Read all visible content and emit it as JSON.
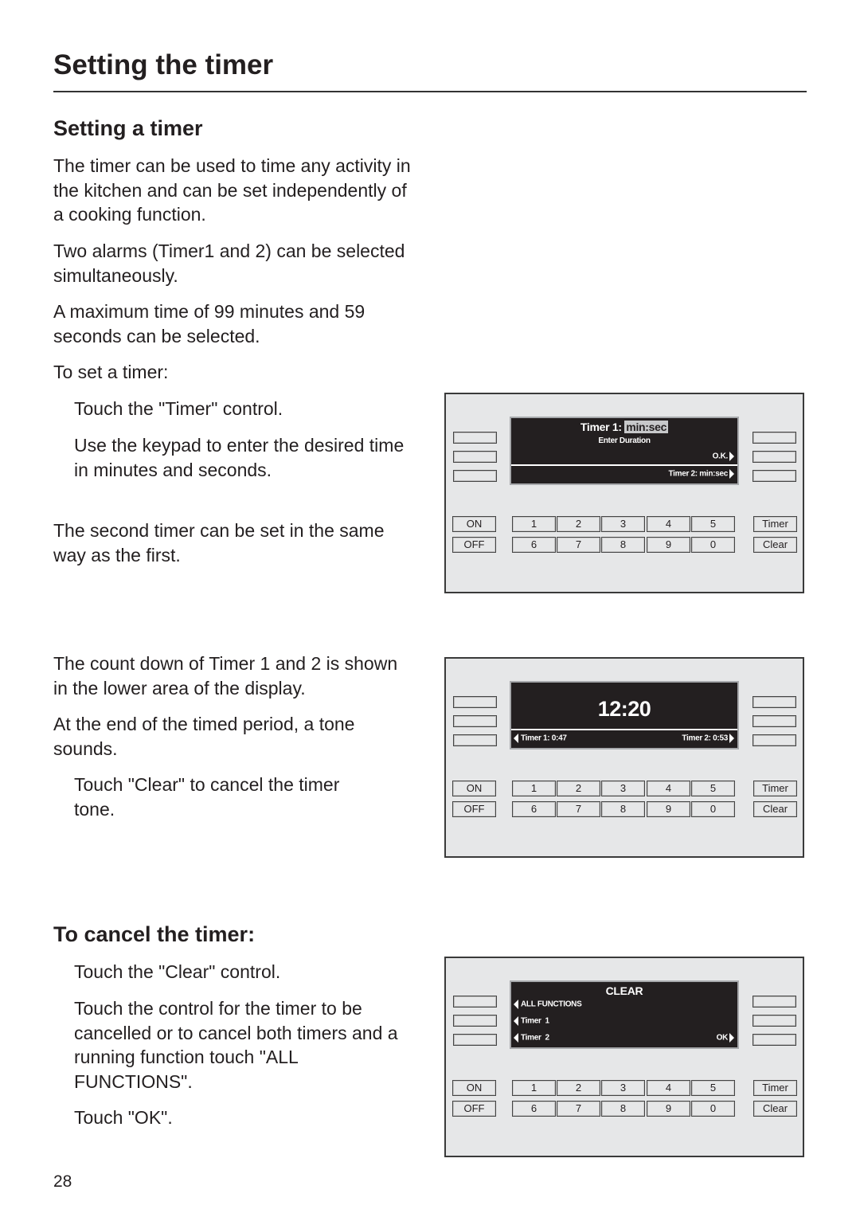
{
  "page": {
    "title": "Setting the timer",
    "page_number": "28"
  },
  "section_setting": {
    "heading": "Setting a timer",
    "paragraphs": [
      "The timer can be used to time any activity in the kitchen and can be set independently of a cooking function.",
      "Two alarms (Timer1 and 2) can be selected simultaneously.",
      "A maximum time of 99 minutes and 59 seconds can be selected.",
      "To set a timer:"
    ],
    "steps": [
      "Touch the \"Timer\" control.",
      "Use the keypad to enter the desired time in minutes and seconds."
    ],
    "note": "The second timer can be set in the same way as the first."
  },
  "section_countdown": {
    "paragraphs": [
      "The count down of Timer 1 and 2 is shown in the lower area of the display.",
      "At the end of the timed period, a tone sounds."
    ],
    "steps": [
      "Touch \"Clear\" to cancel the timer tone."
    ]
  },
  "section_cancel": {
    "heading": "To cancel the timer:",
    "steps": [
      "Touch the \"Clear\" control.",
      "Touch the control for the timer to be cancelled or to cancel both timers and a running function touch \"ALL FUNCTIONS\".",
      "Touch \"OK\"."
    ]
  },
  "control_panel": {
    "keys": {
      "on": "ON",
      "off": "OFF",
      "timer": "Timer",
      "clear": "Clear",
      "row1": [
        "1",
        "2",
        "3",
        "4",
        "5"
      ],
      "row2": [
        "6",
        "7",
        "8",
        "9",
        "0"
      ]
    },
    "colors": {
      "panel_bg": "#e6e7e8",
      "screen_bg": "#231f20",
      "screen_text": "#ffffff",
      "highlight_bg": "#c7c8ca"
    }
  },
  "display_1": {
    "title_prefix": "Timer 1:",
    "title_field": "min:sec",
    "subtitle": "Enter Duration",
    "ok_label": "O.K.",
    "timer2_label": "Timer 2: min:sec"
  },
  "display_2": {
    "clock": "12:20",
    "timer1_status": "Timer 1: 0:47",
    "timer2_status": "Timer 2: 0:53"
  },
  "display_3": {
    "title": "CLEAR",
    "all_functions": "ALL FUNCTIONS",
    "timer1": "Timer  1",
    "timer2": "Timer  2",
    "ok": "OK"
  }
}
